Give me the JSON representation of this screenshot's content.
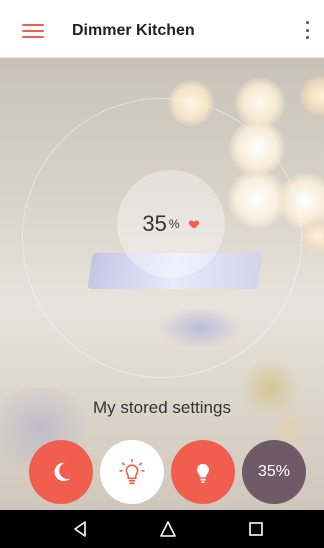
{
  "appbar": {
    "title": "Dimmer Kitchen",
    "menu_icon": "hamburger-menu-icon",
    "overflow_icon": "more-vert-icon"
  },
  "dimmer": {
    "value": "35",
    "unit": "%",
    "level_percent": 35,
    "favorite_icon": "heart-icon"
  },
  "stored_settings": {
    "label": "My stored settings",
    "presets": [
      {
        "icon": "moon-icon",
        "background": "#f15e4e"
      },
      {
        "icon": "lightbulb-outline-icon",
        "background": "#ffffff"
      },
      {
        "icon": "lightbulb-filled-icon",
        "background": "#f15e4e"
      },
      {
        "label": "35%",
        "background": "#6f5a67"
      }
    ]
  },
  "navbar": {
    "back_icon": "back-triangle-icon",
    "home_icon": "home-icon",
    "recents_icon": "recents-square-icon"
  },
  "colors": {
    "accent": "#f15e4e",
    "heart": "#f15e4e",
    "preset_purple": "#6f5a67"
  }
}
